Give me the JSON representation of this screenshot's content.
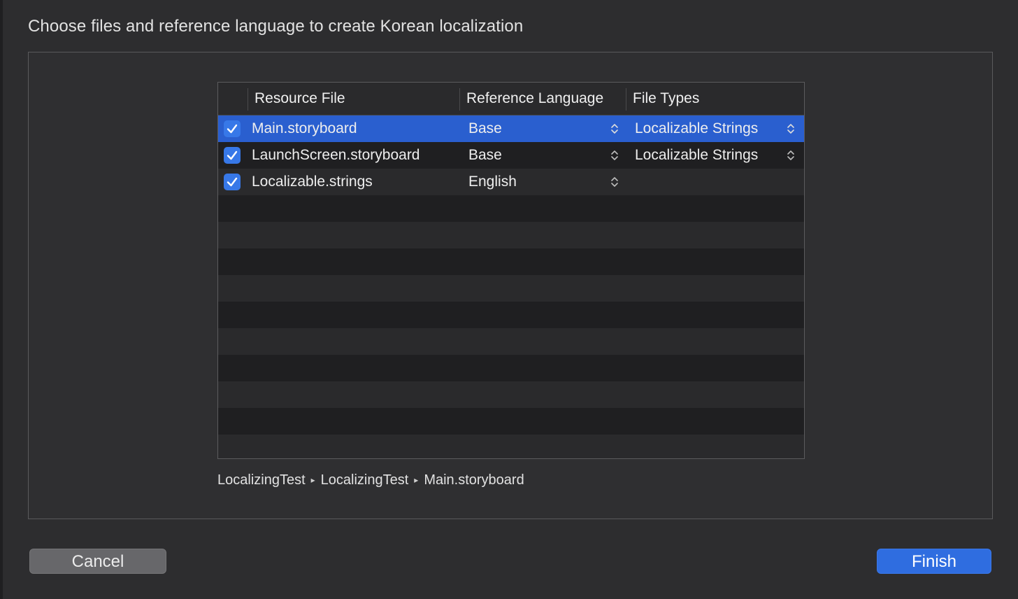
{
  "dialog": {
    "title": "Choose files and reference language to create Korean localization"
  },
  "table": {
    "columns": {
      "resource_file": "Resource File",
      "reference_language": "Reference Language",
      "file_types": "File Types"
    },
    "rows": [
      {
        "checked": true,
        "file": "Main.storyboard",
        "language": "Base",
        "file_type": "Localizable Strings",
        "selected": true
      },
      {
        "checked": true,
        "file": "LaunchScreen.storyboard",
        "language": "Base",
        "file_type": "Localizable Strings",
        "selected": false
      },
      {
        "checked": true,
        "file": "Localizable.strings",
        "language": "English",
        "file_type": "",
        "selected": false
      }
    ]
  },
  "path_bar": {
    "segments": [
      "LocalizingTest",
      "LocalizingTest",
      "Main.storyboard"
    ],
    "separator": "▸"
  },
  "buttons": {
    "cancel": "Cancel",
    "finish": "Finish"
  },
  "colors": {
    "accent": "#2f6de0",
    "selected_row": "#2a5fcf",
    "background": "#2d2d2f"
  }
}
